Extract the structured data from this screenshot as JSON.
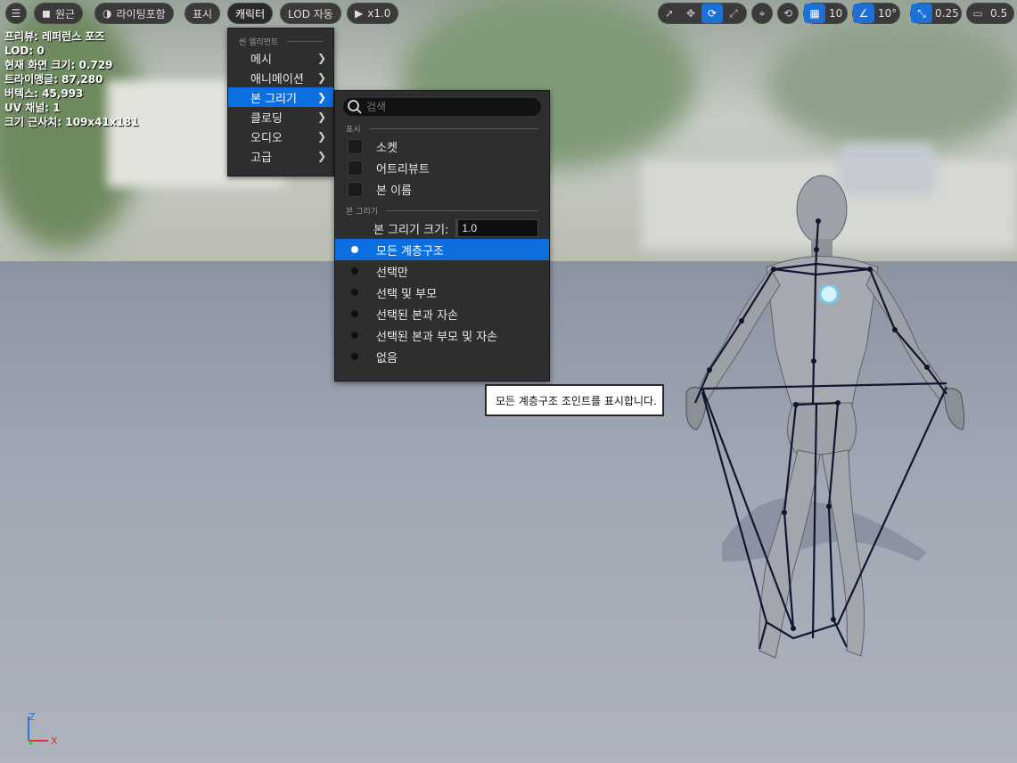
{
  "toolbar": {
    "menu_icon": "hamburger-icon",
    "perspective_label": "원근",
    "lighting_label": "라이팅포함",
    "show_label": "표시",
    "character_label": "캐릭터",
    "lod_label": "LOD 자동",
    "play_speed_label": "x1.0",
    "grid_snap_value": "10",
    "rotation_snap_value": "10°",
    "scale_snap_value": "0.25",
    "camera_speed_value": "0.5"
  },
  "stats": {
    "lines": [
      "프리뷰: 레퍼런스 포즈",
      "LOD: 0",
      "현재 화면 크기: 0.729",
      "트라이앵글: 87,280",
      "버텍스: 45,993",
      "UV 채널: 1",
      "크기 근사치: 109x41x181"
    ]
  },
  "character_menu": {
    "section_label": "씬 엘리먼트",
    "items": [
      {
        "label": "메시"
      },
      {
        "label": "애니메이션"
      },
      {
        "label": "본 그리기",
        "highlighted": true
      },
      {
        "label": "클로딩"
      },
      {
        "label": "오디오"
      },
      {
        "label": "고급"
      }
    ]
  },
  "bone_menu": {
    "search_placeholder": "검색",
    "display_section": "표시",
    "checkboxes": [
      {
        "label": "소켓",
        "checked": false
      },
      {
        "label": "어트리뷰트",
        "checked": false
      },
      {
        "label": "본 이름",
        "checked": false
      }
    ],
    "draw_section": "본 그리기",
    "size_label": "본 그리기 크기:",
    "size_value": "1.0",
    "options": [
      {
        "label": "모든 계층구조",
        "selected": true
      },
      {
        "label": "선택만",
        "selected": false
      },
      {
        "label": "선택 및 부모",
        "selected": false
      },
      {
        "label": "선택된 본과 자손",
        "selected": false
      },
      {
        "label": "선택된 본과 부모 및 자손",
        "selected": false
      },
      {
        "label": "없음",
        "selected": false
      }
    ]
  },
  "tooltip": {
    "text": "모든 계층구조 조인트를 표시합니다."
  },
  "axis": {
    "z_label": "Z",
    "x_label": "X"
  },
  "colors": {
    "accent": "#0d6ee0",
    "axis_x": "#e03030",
    "axis_y": "#30c030",
    "axis_z": "#3070e0",
    "bone": "#111530"
  }
}
